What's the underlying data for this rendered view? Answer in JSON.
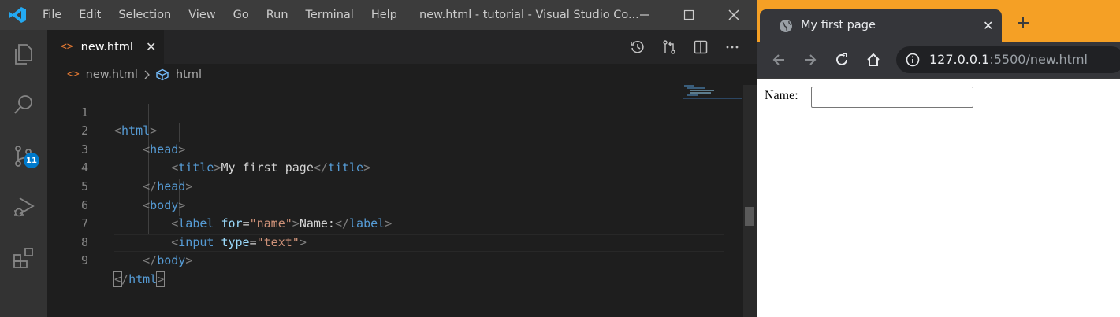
{
  "vscode": {
    "menu": [
      "File",
      "Edit",
      "Selection",
      "View",
      "Go",
      "Run",
      "Terminal",
      "Help"
    ],
    "window_title": "new.html - tutorial - Visual Studio Co...",
    "source_control_badge": "11",
    "tab": {
      "label": "new.html",
      "close": "✕"
    },
    "breadcrumb": {
      "file": "new.html",
      "symbol": "html"
    },
    "line_numbers": [
      "1",
      "2",
      "3",
      "4",
      "5",
      "6",
      "7",
      "8",
      "9"
    ],
    "code": {
      "l1": {
        "tag": "html"
      },
      "l2": {
        "tag": "head"
      },
      "l3": {
        "tag": "title",
        "text": "My first page"
      },
      "l4": {
        "tag": "head"
      },
      "l5": {
        "tag": "body"
      },
      "l6": {
        "tag": "label",
        "attr": "for",
        "value": "\"name\"",
        "text": "Name:"
      },
      "l7": {
        "tag": "input",
        "attr": "type",
        "value": "\"text\""
      },
      "l8": {
        "tag": "body"
      },
      "l9": {
        "tag": "html"
      }
    },
    "icons": {
      "activity": [
        "explorer-icon",
        "search-icon",
        "source-control-icon",
        "run-debug-icon",
        "extensions-icon"
      ],
      "editor_actions": [
        "open-timeline-icon",
        "compare-changes-icon",
        "split-editor-icon",
        "more-actions-icon"
      ]
    },
    "colors": {
      "accent": "#007acc",
      "file_icon": "#e37933",
      "tag": "#569cd6",
      "attr": "#9cdcfe",
      "string": "#ce9178"
    }
  },
  "browser": {
    "tab_title": "My first page",
    "tab_close": "✕",
    "new_tab": "+",
    "url_host": "127.0.0.1",
    "url_rest": ":5500/new.html",
    "page": {
      "label": "Name:",
      "input_value": ""
    },
    "colors": {
      "frame": "#f5a025",
      "toolbar": "#35363a"
    }
  }
}
